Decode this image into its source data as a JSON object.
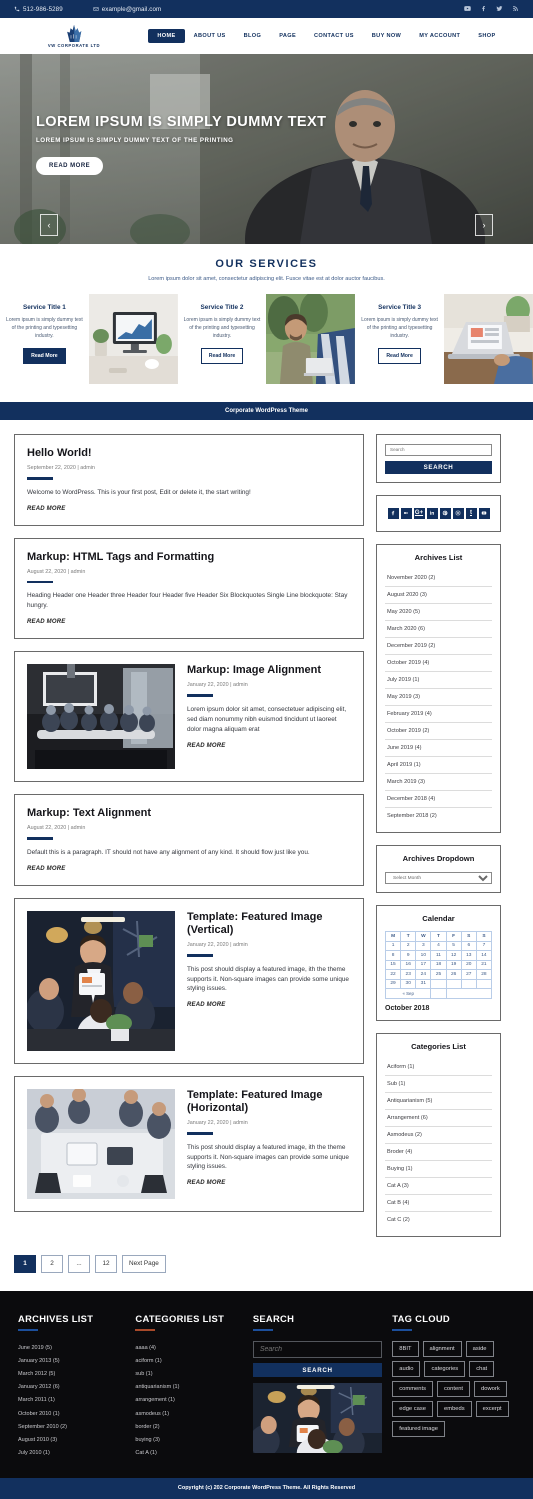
{
  "topbar": {
    "phone": "512-986-5289",
    "email": "example@gmail.com",
    "social": [
      "youtube-icon",
      "facebook-icon",
      "twitter-icon",
      "rss-icon"
    ]
  },
  "brand": {
    "name": "VW CORPORATE LTD"
  },
  "nav": [
    {
      "label": "HOME",
      "active": true
    },
    {
      "label": "ABOUT US",
      "active": false
    },
    {
      "label": "BLOG",
      "active": false
    },
    {
      "label": "PAGE",
      "active": false
    },
    {
      "label": "CONTACT US",
      "active": false
    },
    {
      "label": "BUY NOW",
      "active": false
    },
    {
      "label": "MY ACCOUNT",
      "active": false
    },
    {
      "label": "SHOP",
      "active": false
    }
  ],
  "hero": {
    "title": "LOREM IPSUM IS SIMPLY DUMMY TEXT",
    "subtitle": "LOREM IPSUM IS SIMPLY DUMMY TEXT OF THE PRINTING",
    "button": "READ MORE",
    "prev": "‹",
    "next": "›"
  },
  "services": {
    "heading": "OUR SERVICES",
    "sub": "Lorem ipsum dolor sit amet, consectetur adipiscing elit. Fusce vitae est at dolor auctor faucibus.",
    "items": [
      {
        "title": "Service Title 1",
        "text": "Lorem ipsum is simply dummy text of the printing and typesetting industry.",
        "button": "Read More"
      },
      {
        "title": "Service Title 2",
        "text": "Lorem ipsum is simply dummy text of the printing and typesetting industry.",
        "button": "Read More"
      },
      {
        "title": "Service Title 3",
        "text": "Lorem ipsum is simply dummy text of the printing and typesetting industry.",
        "button": "Read More"
      }
    ]
  },
  "strip": {
    "text": "Corporate WordPress Theme"
  },
  "posts": [
    {
      "title": "Hello World!",
      "meta": "September 22, 2020 | admin",
      "body": "Welcome to WordPress. This is your first post, Edit or delete it, the start writing!",
      "more": "READ MORE",
      "image": false
    },
    {
      "title": "Markup: HTML Tags and Formatting",
      "meta": "August 22, 2020 | admin",
      "body": "Heading Header one Header three Header four Header five Header Six Blockquotes Single Line blockquote: Stay hungry.",
      "more": "READ MORE",
      "image": false
    },
    {
      "title": "Markup: Image Alignment",
      "meta": "January 22, 2020 | admin",
      "body": "Lorem ipsum dolor sit amet, consectetuer adipiscing elit, sed diam nonummy nibh euismod tincidunt ut laoreet dolor magna aliquam erat",
      "more": "READ MORE",
      "image": true
    },
    {
      "title": "Markup: Text Alignment",
      "meta": "August 22, 2020 | admin",
      "body": "Default this is a paragraph. IT should not have any alignment of any kind. It should flow just like you.",
      "more": "READ MORE",
      "image": false
    },
    {
      "title": "Template: Featured Image (Vertical)",
      "meta": "January 22, 2020 | admin",
      "body": "This post should display a featured image, ith the theme supports it. Non-square images can provide some unique styling issues.",
      "more": "READ MORE",
      "image": true
    },
    {
      "title": "Template: Featured Image (Horizontal)",
      "meta": "January 22, 2020 | admin",
      "body": "This post should display a featured image, ith the theme supports it. Non-square images can provide some unique styling issues.",
      "more": "READ MORE",
      "image": true
    }
  ],
  "sidebar": {
    "search": {
      "placeholder": "Search",
      "button": "SEARCH"
    },
    "social_icons": [
      "facebook-icon",
      "flickr-icon",
      "googleplus-icon",
      "linkedin-icon",
      "pinterest-icon",
      "instagram-icon",
      "tumblr-icon",
      "youtube-icon"
    ],
    "archives": {
      "title": "Archives List",
      "items": [
        "November 2020 (2)",
        "August 2020 (3)",
        "May 2020 (5)",
        "March 2020 (6)",
        "December 2019 (2)",
        "October 2019 (4)",
        "July 2019 (1)",
        "May 2019 (3)",
        "February 2019 (4)",
        "October 2019 (2)",
        "June 2019 (4)",
        "April 2019 (1)",
        "March 2019 (3)",
        "December 2018 (4)",
        "September 2018 (2)"
      ]
    },
    "archives_dropdown": {
      "title": "Archives Dropdown",
      "selected": "Select Month"
    },
    "calendar": {
      "title": "Calendar",
      "days": [
        "M",
        "T",
        "W",
        "T",
        "F",
        "S",
        "S"
      ],
      "weeks": [
        [
          "1",
          "2",
          "3",
          "4",
          "5",
          "6",
          "7"
        ],
        [
          "8",
          "9",
          "10",
          "11",
          "12",
          "13",
          "14"
        ],
        [
          "15",
          "16",
          "17",
          "18",
          "19",
          "20",
          "21"
        ],
        [
          "22",
          "23",
          "24",
          "25",
          "26",
          "27",
          "28"
        ],
        [
          "29",
          "30",
          "31",
          "",
          "",
          "",
          ""
        ]
      ],
      "prev": "« Sep",
      "caption": "October 2018"
    },
    "categories": {
      "title": "Categories List",
      "items": [
        "Aciform (1)",
        "Sub (1)",
        "Antiquarianism (5)",
        "Arrangement (6)",
        "Asmodeus (2)",
        "Broder (4)",
        "Buying (1)",
        "Cat A (3)",
        "Cat B (4)",
        "Cat C (2)"
      ]
    }
  },
  "pagination": [
    {
      "label": "1",
      "current": true
    },
    {
      "label": "2",
      "current": false
    },
    {
      "label": "...",
      "current": false
    },
    {
      "label": "12",
      "current": false
    },
    {
      "label": "Next Page",
      "current": false
    }
  ],
  "footer": {
    "archives": {
      "title": "ARCHIVES LIST",
      "items": [
        "June 2019 (5)",
        "January  2013 (5)",
        "March 2012 (5)",
        "January  2012 (6)",
        "March  2011 (1)",
        "October 2010 (1)",
        "September 2010 (2)",
        "August 2010 (3)",
        "July 2010 (1)"
      ]
    },
    "categories": {
      "title": "CATEGORIES LIST",
      "items": [
        "aaaa (4)",
        "aciform (1)",
        "sub (1)",
        "antiquarianism (1)",
        "arrangement (1)",
        "asmodeus (1)",
        "border (2)",
        "buying (3)",
        "Cat A (1)"
      ]
    },
    "search": {
      "title": "SEARCH",
      "placeholder": "Search",
      "button": "SEARCH"
    },
    "tagcloud": {
      "title": "TAG CLOUD",
      "tags": [
        "8BIT",
        "alignment",
        "aside",
        "audio",
        "categories",
        "chat",
        "comments",
        "content",
        "dowork",
        "edge case",
        "embeds",
        "excerpt",
        "featured image"
      ]
    }
  },
  "copyright": {
    "text": "Copyright (c) 202 Corporate WordPress Theme. All Rights Reserved"
  },
  "colors": {
    "navy": "#12305e",
    "dark": "#0b0b0d",
    "accent": "#1c4f9c"
  }
}
